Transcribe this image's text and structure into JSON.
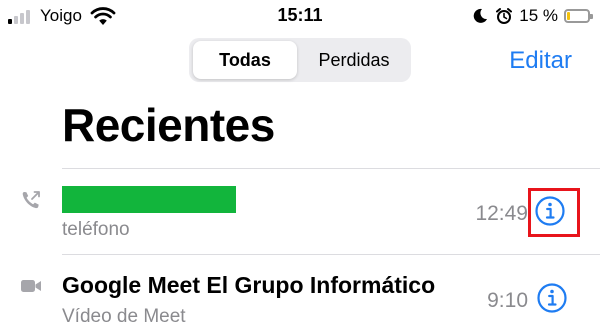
{
  "status_bar": {
    "carrier": "Yoigo",
    "time": "15:11",
    "battery_percent": "15 %",
    "battery_level": 0.15,
    "signal_bars_filled": 1,
    "signal_bars_total": 4,
    "icons": [
      "signal-icon",
      "wifi-icon",
      "moon-icon",
      "alarm-icon",
      "battery-icon"
    ]
  },
  "nav": {
    "segments": [
      {
        "label": "Todas",
        "selected": true
      },
      {
        "label": "Perdidas",
        "selected": false
      }
    ],
    "edit_label": "Editar"
  },
  "page": {
    "title": "Recientes"
  },
  "calls": [
    {
      "name": "",
      "name_redacted": true,
      "subtitle": "teléfono",
      "time": "12:49",
      "type_icon": "outgoing-call-icon",
      "info_icon": "info-icon",
      "highlighted": true
    },
    {
      "name": "Google Meet El Grupo Informático",
      "subtitle": "Vídeo de Meet",
      "time": "9:10",
      "type_icon": "video-call-icon",
      "info_icon": "info-icon",
      "highlighted": false
    }
  ],
  "colors": {
    "accent": "#1e7cf2",
    "secondary_text": "#8a8a8e",
    "redaction": "#12b53c",
    "highlight": "#e8141b",
    "battery": "#f4c20d"
  }
}
